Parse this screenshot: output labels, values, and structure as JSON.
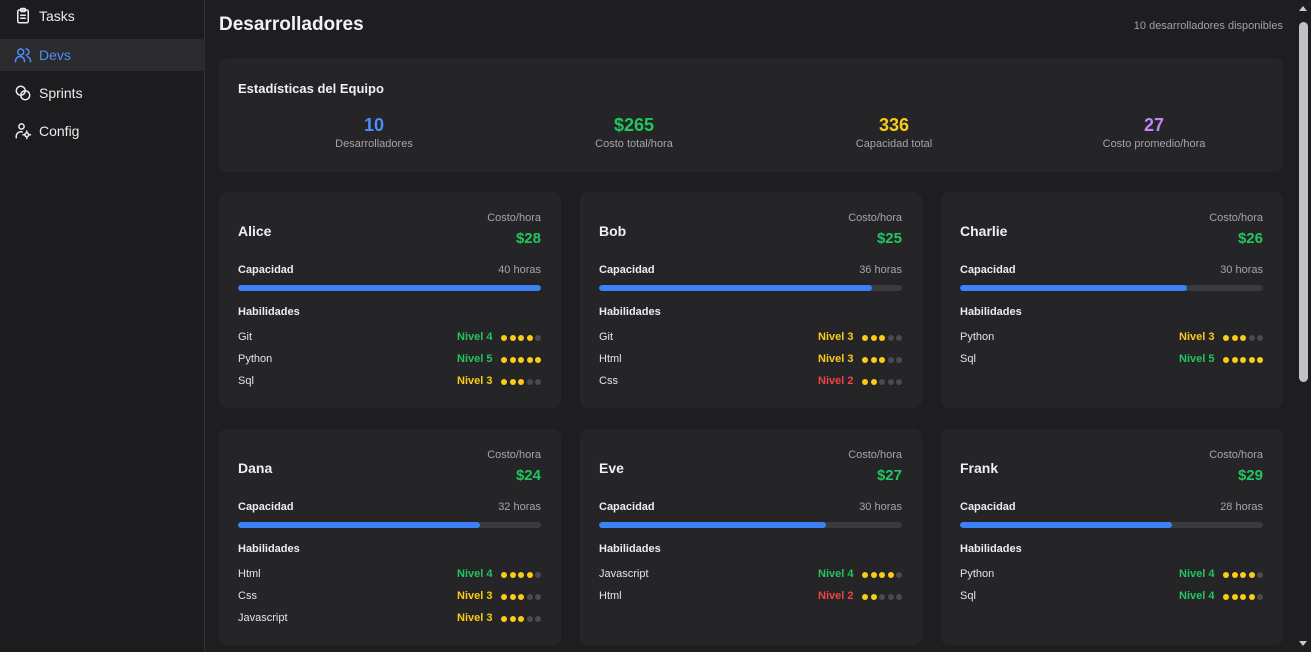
{
  "sidebar": {
    "items": [
      {
        "label": "Tasks",
        "icon": "clipboard-icon",
        "active": false
      },
      {
        "label": "Devs",
        "icon": "users-icon",
        "active": true
      },
      {
        "label": "Sprints",
        "icon": "link-icon",
        "active": false
      },
      {
        "label": "Config",
        "icon": "settings-icon",
        "active": false
      }
    ]
  },
  "header": {
    "title": "Desarrolladores",
    "available": "10 desarrolladores disponibles"
  },
  "stats": {
    "title": "Estadísticas del Equipo",
    "items": [
      {
        "value": "10",
        "label": "Desarrolladores",
        "color": "#4b8ef7"
      },
      {
        "value": "$265",
        "label": "Costo total/hora",
        "color": "#22c55e"
      },
      {
        "value": "336",
        "label": "Capacidad total",
        "color": "#facc15"
      },
      {
        "value": "27",
        "label": "Costo promedio/hora",
        "color": "#c084fc"
      }
    ]
  },
  "labels": {
    "cost": "Costo/hora",
    "capacity": "Capacidad",
    "skills": "Habilidades"
  },
  "level_colors": {
    "2": "#ef4444",
    "3": "#facc15",
    "4": "#22c55e",
    "5": "#22c55e"
  },
  "devs": [
    {
      "name": "Alice",
      "cost": "$28",
      "capacity": "40 horas",
      "capacity_fraction": 1.0,
      "skills": [
        {
          "name": "Git",
          "level_label": "Nivel 4",
          "level": 4
        },
        {
          "name": "Python",
          "level_label": "Nivel 5",
          "level": 5
        },
        {
          "name": "Sql",
          "level_label": "Nivel 3",
          "level": 3
        }
      ]
    },
    {
      "name": "Bob",
      "cost": "$25",
      "capacity": "36 horas",
      "capacity_fraction": 0.9,
      "skills": [
        {
          "name": "Git",
          "level_label": "Nivel 3",
          "level": 3
        },
        {
          "name": "Html",
          "level_label": "Nivel 3",
          "level": 3
        },
        {
          "name": "Css",
          "level_label": "Nivel 2",
          "level": 2
        }
      ]
    },
    {
      "name": "Charlie",
      "cost": "$26",
      "capacity": "30 horas",
      "capacity_fraction": 0.75,
      "skills": [
        {
          "name": "Python",
          "level_label": "Nivel 3",
          "level": 3
        },
        {
          "name": "Sql",
          "level_label": "Nivel 5",
          "level": 5
        }
      ]
    },
    {
      "name": "Dana",
      "cost": "$24",
      "capacity": "32 horas",
      "capacity_fraction": 0.8,
      "skills": [
        {
          "name": "Html",
          "level_label": "Nivel 4",
          "level": 4
        },
        {
          "name": "Css",
          "level_label": "Nivel 3",
          "level": 3
        },
        {
          "name": "Javascript",
          "level_label": "Nivel 3",
          "level": 3
        }
      ]
    },
    {
      "name": "Eve",
      "cost": "$27",
      "capacity": "30 horas",
      "capacity_fraction": 0.75,
      "skills": [
        {
          "name": "Javascript",
          "level_label": "Nivel 4",
          "level": 4
        },
        {
          "name": "Html",
          "level_label": "Nivel 2",
          "level": 2
        }
      ]
    },
    {
      "name": "Frank",
      "cost": "$29",
      "capacity": "28 horas",
      "capacity_fraction": 0.7,
      "skills": [
        {
          "name": "Python",
          "level_label": "Nivel 4",
          "level": 4
        },
        {
          "name": "Sql",
          "level_label": "Nivel 4",
          "level": 4
        }
      ]
    }
  ]
}
